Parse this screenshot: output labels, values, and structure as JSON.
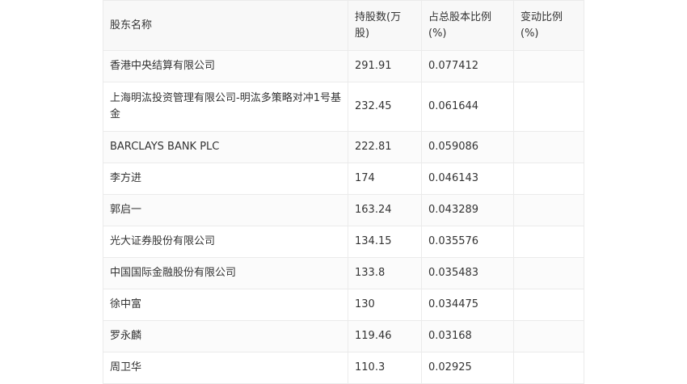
{
  "table": {
    "headers": [
      "股东名称",
      "持股数(万股)",
      "占总股本比例(%)",
      "变动比例(%)"
    ],
    "rows": [
      [
        "香港中央结算有限公司",
        "291.91",
        "0.077412",
        ""
      ],
      [
        "上海明汯投资管理有限公司-明汯多策略对冲1号基金",
        "232.45",
        "0.061644",
        ""
      ],
      [
        "BARCLAYS BANK PLC",
        "222.81",
        "0.059086",
        ""
      ],
      [
        "李方进",
        "174",
        "0.046143",
        ""
      ],
      [
        "郭启一",
        "163.24",
        "0.043289",
        ""
      ],
      [
        "光大证券股份有限公司",
        "134.15",
        "0.035576",
        ""
      ],
      [
        "中国国际金融股份有限公司",
        "133.8",
        "0.035483",
        ""
      ],
      [
        "徐中富",
        "130",
        "0.034475",
        ""
      ],
      [
        "罗永麟",
        "119.46",
        "0.03168",
        ""
      ],
      [
        "周卫华",
        "110.3",
        "0.02925",
        ""
      ]
    ]
  }
}
